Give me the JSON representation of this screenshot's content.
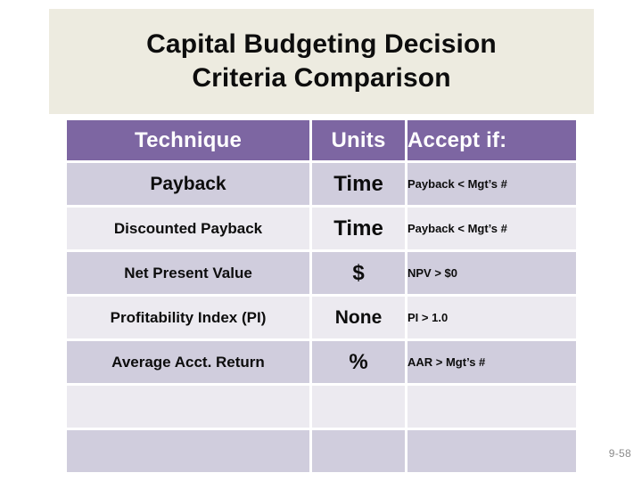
{
  "slide": {
    "title": "Capital Budgeting Decision\nCriteria Comparison",
    "page_number": "9-58",
    "colors": {
      "title_background": "#edebe0",
      "title_text": "#0d0d0d",
      "header_background": "#7d66a2",
      "header_text": "#ffffff",
      "row_dark": "#d0cddd",
      "row_light": "#eceaf0",
      "page_number_text": "#8a8a8a",
      "slide_background": "#ffffff"
    }
  },
  "table": {
    "columns": [
      "Technique",
      "Units",
      "Accept if:"
    ],
    "rows": [
      {
        "technique": "Payback",
        "units": "Time",
        "accept_if": "Payback < Mgt’s #"
      },
      {
        "technique": "Discounted Payback",
        "units": "Time",
        "accept_if": "Payback < Mgt’s #"
      },
      {
        "technique": "Net Present Value",
        "units": "$",
        "accept_if": "NPV > $0"
      },
      {
        "technique": "Profitability Index (PI)",
        "units": "None",
        "accept_if": "PI > 1.0"
      },
      {
        "technique": "Average Acct. Return",
        "units": "%",
        "accept_if": "AAR > Mgt’s #"
      },
      {
        "technique": "",
        "units": "",
        "accept_if": ""
      },
      {
        "technique": "",
        "units": "",
        "accept_if": ""
      }
    ]
  }
}
